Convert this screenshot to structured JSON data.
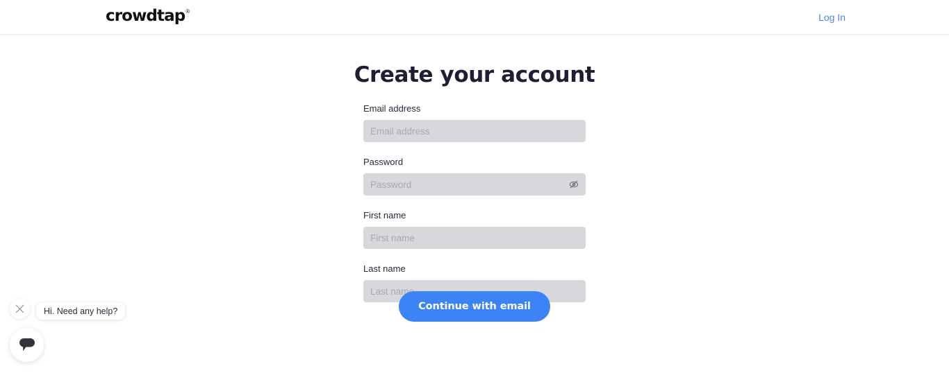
{
  "header": {
    "logo_text": "crowdtap",
    "logo_tm": "®",
    "login_label": "Log In"
  },
  "main": {
    "title": "Create your account",
    "fields": [
      {
        "name": "email",
        "label": "Email address",
        "placeholder": "Email address",
        "value": ""
      },
      {
        "name": "password",
        "label": "Password",
        "placeholder": "Password",
        "value": "",
        "toggle_icon": "eye-slash-icon"
      },
      {
        "name": "first_name",
        "label": "First name",
        "placeholder": "First name",
        "value": ""
      },
      {
        "name": "last_name",
        "label": "Last name",
        "placeholder": "Last name",
        "value": ""
      }
    ],
    "submit_label": "Continue with email"
  },
  "chat_widget": {
    "message": "Hi. Need any help?",
    "close_icon": "close-icon",
    "launcher_icon": "chat-bubble-icon"
  },
  "colors": {
    "accent_blue": "#3b83f6",
    "link_blue": "#4285f4",
    "title_navy": "#201d37",
    "input_bg": "#d7d7dc",
    "placeholder": "#a9a9b2"
  }
}
